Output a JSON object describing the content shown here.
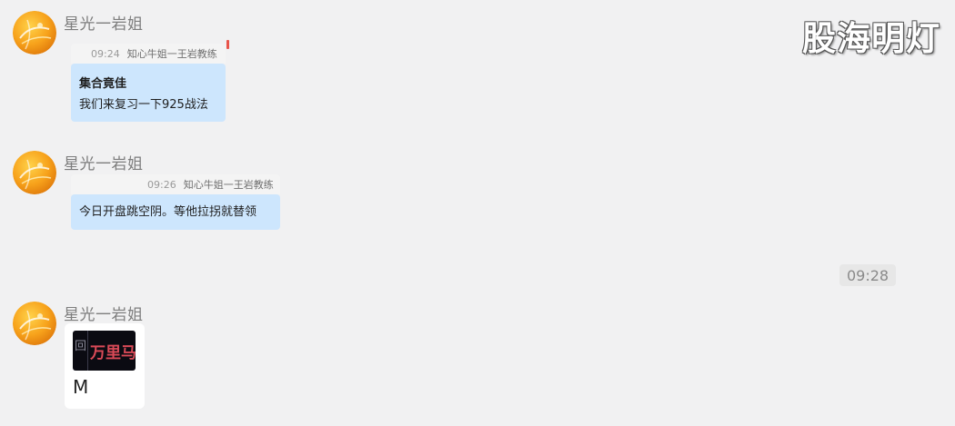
{
  "watermark": "股海明灯",
  "time_divider": "09:28",
  "messages": [
    {
      "sender": "星光一岩姐",
      "quote_time": "09:24",
      "quote_from": "知心牛姐一王岩教练",
      "lines": [
        "集合竟佳",
        "我们来复习一下925战法"
      ]
    },
    {
      "sender": "星光一岩姐",
      "quote_time": "09:26",
      "quote_from": "知心牛姐一王岩教练",
      "lines": [
        "今日开盘跳空阴。等他拉拐就替领"
      ]
    },
    {
      "sender": "星光一岩姐",
      "thumb_text": "万里马",
      "thumb_edge": "回",
      "caption": "M"
    }
  ],
  "colors": {
    "bubble": "#cde6fd",
    "background": "#f1f1f2",
    "thumb_text": "#d94a57"
  }
}
